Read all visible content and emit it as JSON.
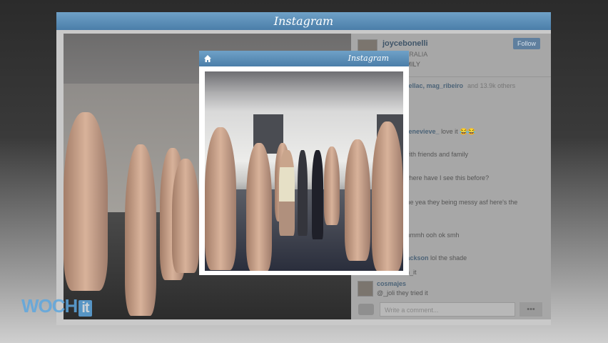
{
  "app_title": "Instagram",
  "popup_title": "Instagram",
  "profile": {
    "username": "joycebonelli",
    "location": "AUSTRALIA",
    "caption": "RNE FAMILY",
    "follow_label": "Follow"
  },
  "likes": {
    "users": "shellac, mag_ribeiro",
    "extra": "and 13.9k others"
  },
  "comments": [
    {
      "user": "genevieve_",
      "text": "love it 😂😂"
    },
    {
      "user": "",
      "text": "with friends and family"
    },
    {
      "user": "",
      "text": "where have I see this before?"
    },
    {
      "user": "",
      "text": "the yea they being messy asf here's the"
    },
    {
      "user": "",
      "text": "mmmh ooh ok smh"
    },
    {
      "user": "jackson",
      "text": "lol the shade"
    },
    {
      "user": "",
      "text": "in_it"
    },
    {
      "user": "cosmajes",
      "text": ""
    },
    {
      "user": "",
      "text": "@_joli they tried it"
    }
  ],
  "comment_placeholder": "Write a comment...",
  "more_label": "•••",
  "watermark": {
    "brand": "WOCH",
    "suffix": "it"
  }
}
